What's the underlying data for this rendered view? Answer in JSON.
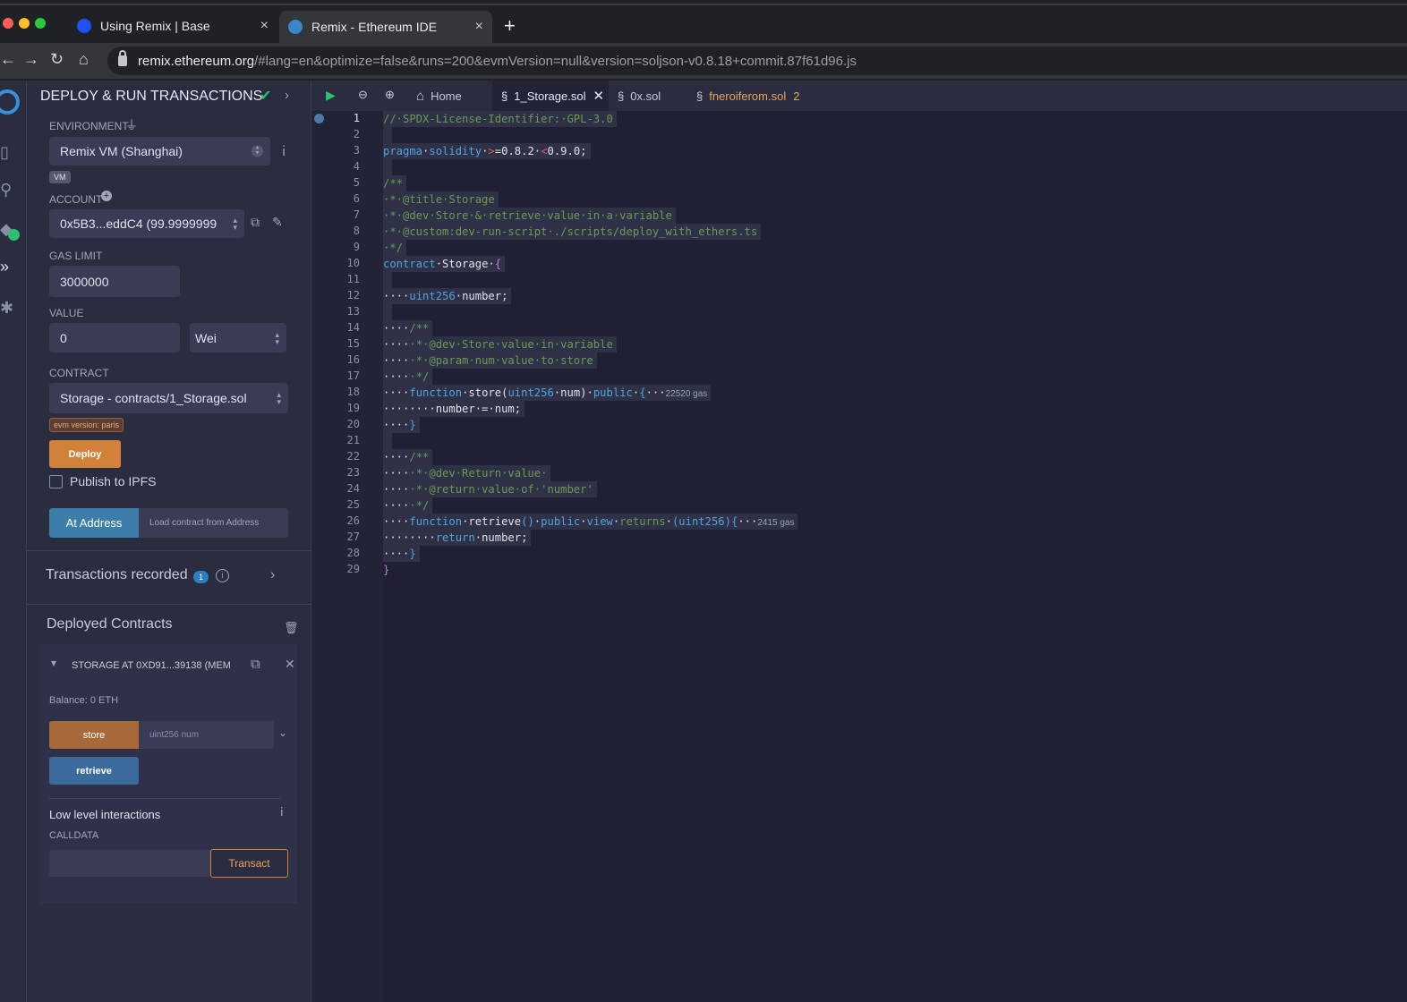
{
  "browser": {
    "tabs": [
      {
        "title": "Using Remix | Base",
        "close": "×"
      },
      {
        "title": "Remix - Ethereum IDE",
        "close": "×"
      }
    ],
    "new_tab": "+",
    "url_host": "remix.ethereum.org",
    "url_path": "/#lang=en&optimize=false&runs=200&evmVersion=null&version=soljson-v0.8.18+commit.87f61d96.js"
  },
  "panel": {
    "title": "DEPLOY & RUN TRANSACTIONS",
    "environment_label": "ENVIRONMENT",
    "environment_value": "Remix VM (Shanghai)",
    "vm_badge": "VM",
    "account_label": "ACCOUNT",
    "account_value": "0x5B3...eddC4 (99.9999999",
    "gas_limit_label": "GAS LIMIT",
    "gas_limit_value": "3000000",
    "value_label": "VALUE",
    "value_amount": "0",
    "value_unit": "Wei",
    "contract_label": "CONTRACT",
    "contract_value": "Storage - contracts/1_Storage.sol",
    "evm_badge": "evm version: paris",
    "deploy_label": "Deploy",
    "publish_label": "Publish to IPFS",
    "at_address_label": "At Address",
    "load_contract_placeholder": "Load contract from Address",
    "transactions_label": "Transactions recorded",
    "transactions_count": "1",
    "deployed_label": "Deployed Contracts",
    "instance_title": "STORAGE AT 0XD91...39138 (MEM",
    "balance": "Balance: 0 ETH",
    "store_label": "store",
    "store_placeholder": "uint256 num",
    "retrieve_label": "retrieve",
    "low_level_label": "Low level interactions",
    "calldata_label": "CALLDATA",
    "transact_label": "Transact"
  },
  "editor": {
    "home_label": "Home",
    "tabs": [
      {
        "label": "1_Storage.sol"
      },
      {
        "label": "0x.sol"
      },
      {
        "label": "fneroiferom.sol",
        "count": "2"
      }
    ],
    "line_numbers": [
      "1",
      "2",
      "3",
      "4",
      "5",
      "6",
      "7",
      "8",
      "9",
      "10",
      "11",
      "12",
      "13",
      "14",
      "15",
      "16",
      "17",
      "18",
      "19",
      "20",
      "21",
      "22",
      "23",
      "24",
      "25",
      "26",
      "27",
      "28",
      "29"
    ],
    "gas_store": "22520 gas",
    "gas_retrieve": "2415 gas"
  }
}
